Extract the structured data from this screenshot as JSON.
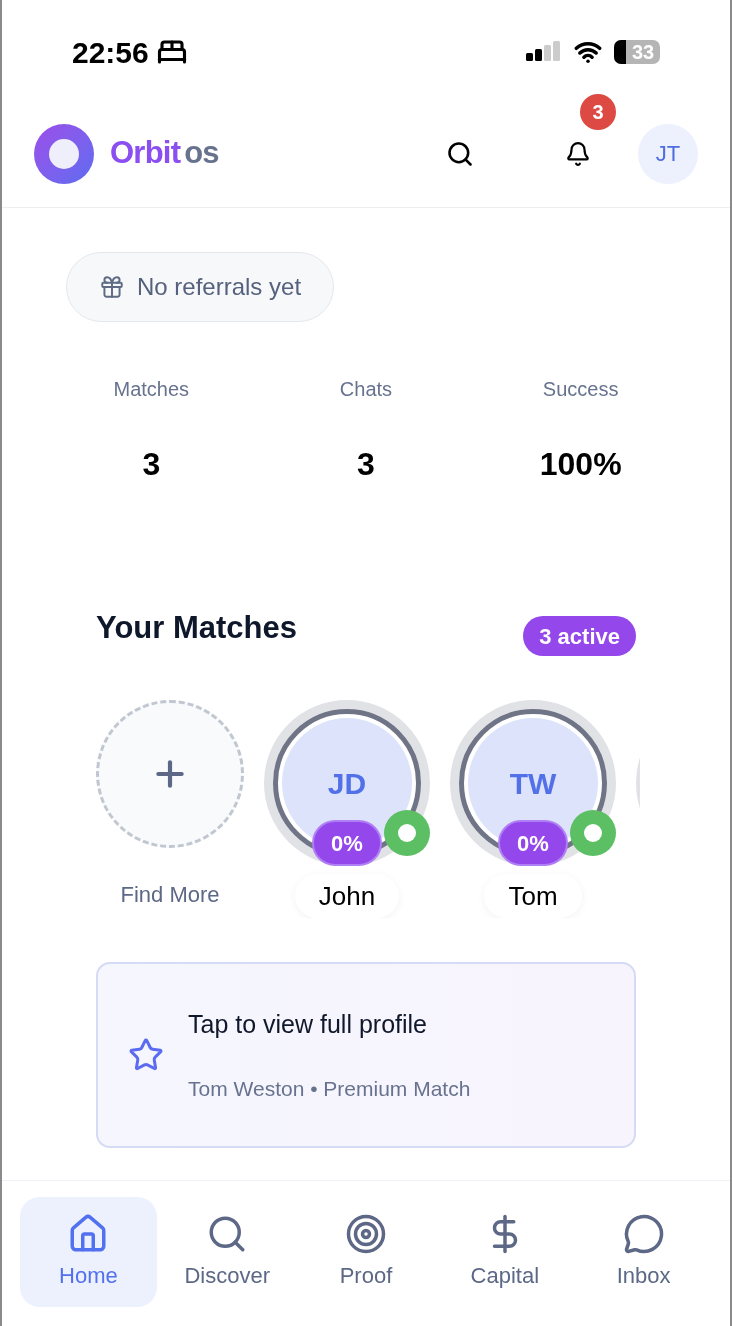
{
  "status_bar": {
    "time": "22:56",
    "battery": "33"
  },
  "header": {
    "brand_primary": "Orbit",
    "brand_secondary": "os",
    "notification_count": "3",
    "avatar": "JT"
  },
  "referral": {
    "label": "No referrals yet"
  },
  "stats": [
    {
      "label": "Matches",
      "value": "3"
    },
    {
      "label": "Chats",
      "value": "3"
    },
    {
      "label": "Success",
      "value": "100%"
    }
  ],
  "matches": {
    "title": "Your Matches",
    "badge": "3 active",
    "find_more": "Find More",
    "items": [
      {
        "initials": "JD",
        "name": "John",
        "score": "0%",
        "online": true
      },
      {
        "initials": "TW",
        "name": "Tom",
        "score": "0%",
        "online": true
      }
    ]
  },
  "profile_card": {
    "title": "Tap to view full profile",
    "subtitle": "Tom Weston • Premium Match"
  },
  "nav": [
    {
      "label": "Home",
      "selected": true
    },
    {
      "label": "Discover",
      "selected": false
    },
    {
      "label": "Proof",
      "selected": false
    },
    {
      "label": "Capital",
      "selected": false
    },
    {
      "label": "Inbox",
      "selected": false
    }
  ]
}
